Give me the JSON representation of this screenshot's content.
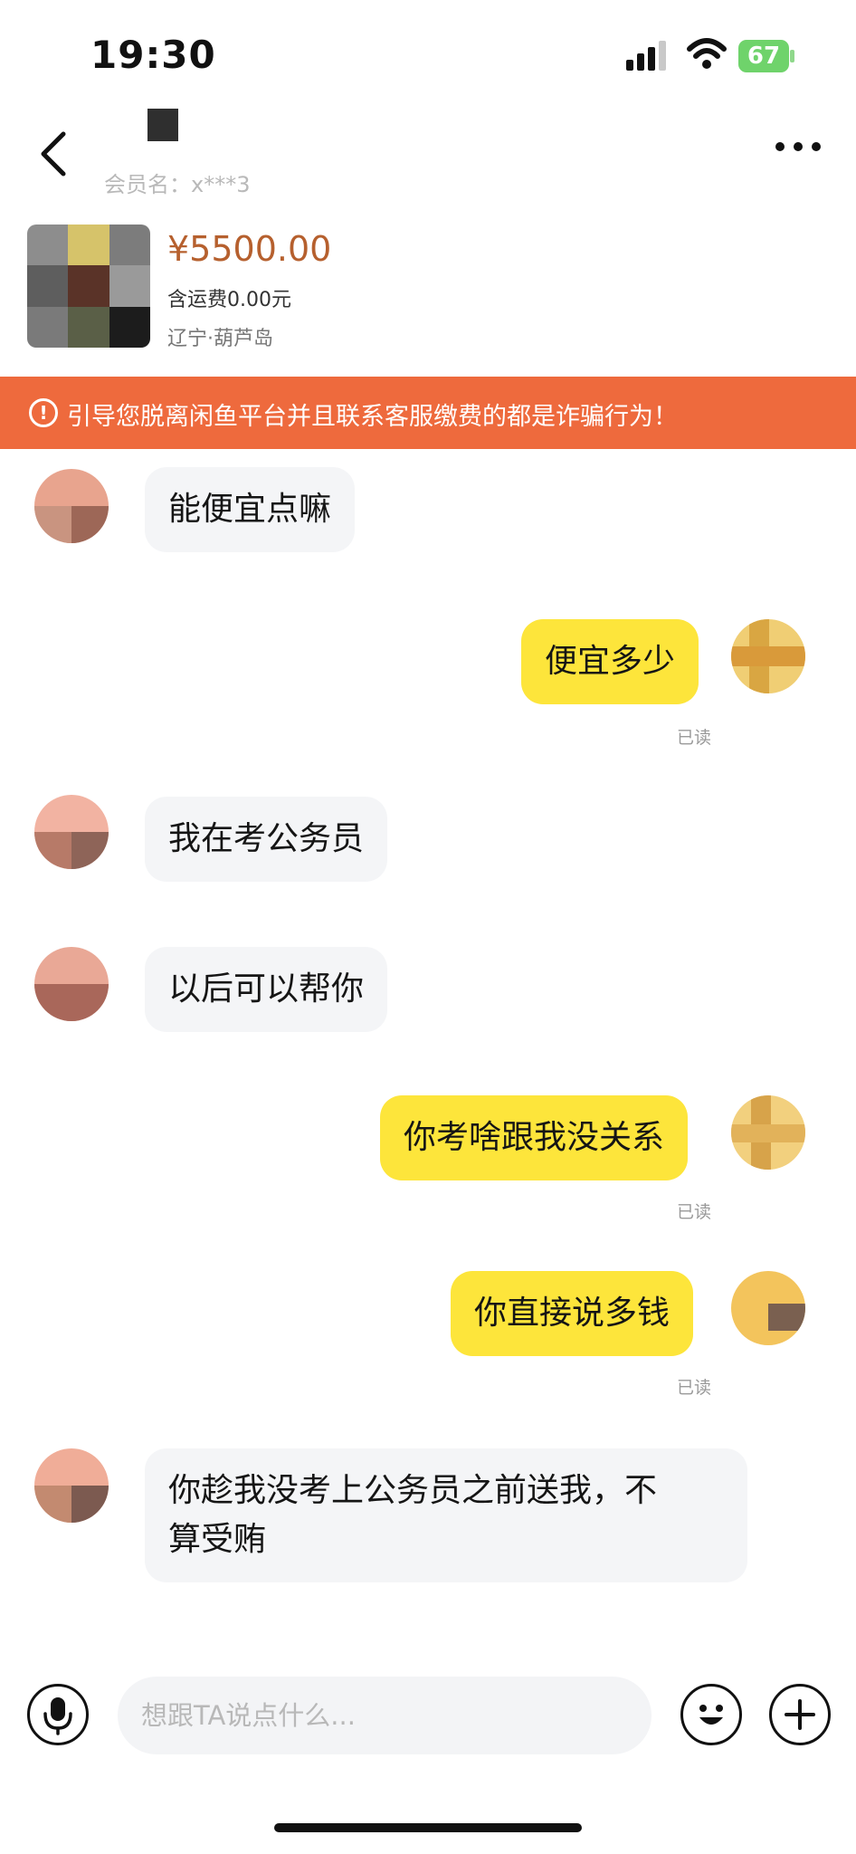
{
  "status_bar": {
    "time": "19:30",
    "battery": "67"
  },
  "header": {
    "member_label": "会员名：x***3",
    "back_icon": "chevron-left-icon",
    "more_icon": "more-horizontal-icon"
  },
  "product": {
    "price": "¥5500.00",
    "shipping": "含运费0.00元",
    "location": "辽宁·葫芦岛"
  },
  "warning": {
    "icon": "!",
    "text": "引导您脱离闲鱼平台并且联系客服缴费的都是诈骗行为！"
  },
  "messages": [
    {
      "side": "in",
      "text": "能便宜点嘛"
    },
    {
      "side": "out",
      "text": "便宜多少",
      "status": "已读"
    },
    {
      "side": "in",
      "text": "我在考公务员"
    },
    {
      "side": "in",
      "text": "以后可以帮你"
    },
    {
      "side": "out",
      "text": "你考啥跟我没关系",
      "status": "已读"
    },
    {
      "side": "out",
      "text": "你直接说多钱",
      "status": "已读"
    },
    {
      "side": "in",
      "text_line1": "你趁我没考上公务员之前送我，不",
      "text_line2": "算受贿"
    }
  ],
  "input_bar": {
    "placeholder": "想跟TA说点什么...",
    "mic_icon": "microphone-icon",
    "emoji_icon": "emoji-icon",
    "plus_icon": "plus-icon"
  },
  "colors": {
    "price": "#b6602e",
    "warning_bg": "#ee6a3d",
    "outgoing_bubble": "#fde53b",
    "incoming_bubble": "#f4f5f7"
  }
}
